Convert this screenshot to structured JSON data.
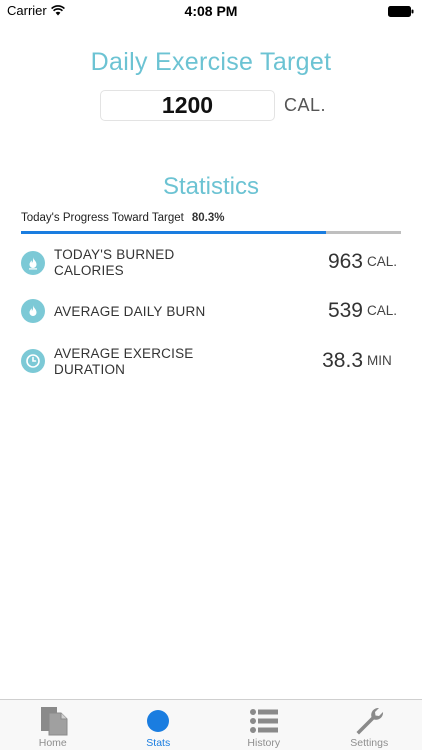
{
  "status_bar": {
    "carrier": "Carrier",
    "time": "4:08 PM"
  },
  "target": {
    "title": "Daily Exercise Target",
    "value": "1200",
    "unit": "CAL."
  },
  "statistics": {
    "title": "Statistics",
    "progress_label": "Today's Progress Toward Target",
    "progress_value": "80.3%",
    "progress_fraction": 0.803,
    "rows": [
      {
        "icon": "flame-icon",
        "label": "TODAY'S BURNED CALORIES",
        "value": "963",
        "unit": "CAL."
      },
      {
        "icon": "flame-icon",
        "label": "AVERAGE DAILY BURN",
        "value": "539",
        "unit": "CAL."
      },
      {
        "icon": "clock-icon",
        "label": "AVERAGE EXERCISE DURATION",
        "value": "38.3",
        "unit": "MIN"
      }
    ]
  },
  "tab_bar": {
    "tabs": [
      {
        "label": "Home",
        "icon": "home-document-icon",
        "active": false
      },
      {
        "label": "Stats",
        "icon": "stats-dot-icon",
        "active": true
      },
      {
        "label": "History",
        "icon": "list-icon",
        "active": false
      },
      {
        "label": "Settings",
        "icon": "wrench-icon",
        "active": false
      }
    ]
  },
  "colors": {
    "accent_teal": "#6cc3d3",
    "accent_blue": "#1a7de0",
    "icon_teal": "#7cc9d6"
  }
}
